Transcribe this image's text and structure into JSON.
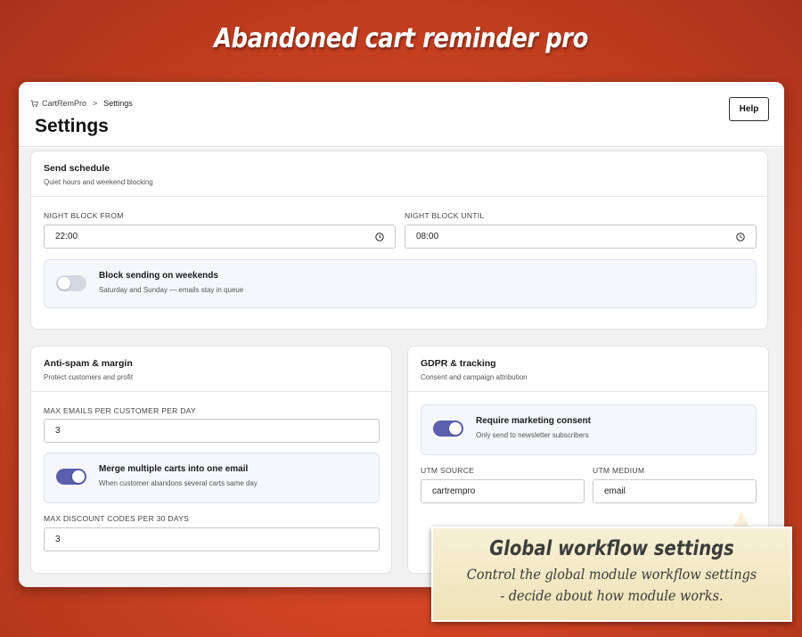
{
  "banner": {
    "title": "Abandoned cart reminder pro"
  },
  "header": {
    "breadcrumb": {
      "root": "CartRemPro",
      "separator": ">",
      "current": "Settings"
    },
    "title": "Settings",
    "help_label": "Help"
  },
  "send_schedule": {
    "title": "Send schedule",
    "subtitle": "Quiet hours and weekend blocking",
    "night_from_label": "NIGHT BLOCK FROM",
    "night_from_value": "22:00",
    "night_until_label": "NIGHT BLOCK UNTIL",
    "night_until_value": "08:00",
    "weekend_toggle": {
      "title": "Block sending on weekends",
      "subtitle": "Saturday and Sunday — emails stay in queue",
      "enabled": false
    }
  },
  "anti_spam": {
    "title": "Anti-spam & margin",
    "subtitle": "Protect customers and profit",
    "max_emails_label": "MAX EMAILS PER CUSTOMER PER DAY",
    "max_emails_value": "3",
    "merge_toggle": {
      "title": "Merge multiple carts into one email",
      "subtitle": "When customer abandons several carts same day",
      "enabled": true
    },
    "max_discount_label": "MAX DISCOUNT CODES PER 30 DAYS",
    "max_discount_value": "3"
  },
  "gdpr": {
    "title": "GDPR & tracking",
    "subtitle": "Consent and campaign attribution",
    "consent_toggle": {
      "title": "Require marketing consent",
      "subtitle": "Only send to newsletter subscribers",
      "enabled": true
    },
    "utm_source_label": "UTM SOURCE",
    "utm_source_value": "cartrempro",
    "utm_medium_label": "UTM MEDIUM",
    "utm_medium_value": "email"
  },
  "callout": {
    "title": "Global workflow settings",
    "line1": "Control the global module workflow settings",
    "line2": "- decide about how module works."
  },
  "colors": {
    "accent": "#5a5fae",
    "background": "#cf4423",
    "toggle_off": "#d6d9e1"
  },
  "icons": [
    "cart-icon",
    "clock-icon"
  ]
}
